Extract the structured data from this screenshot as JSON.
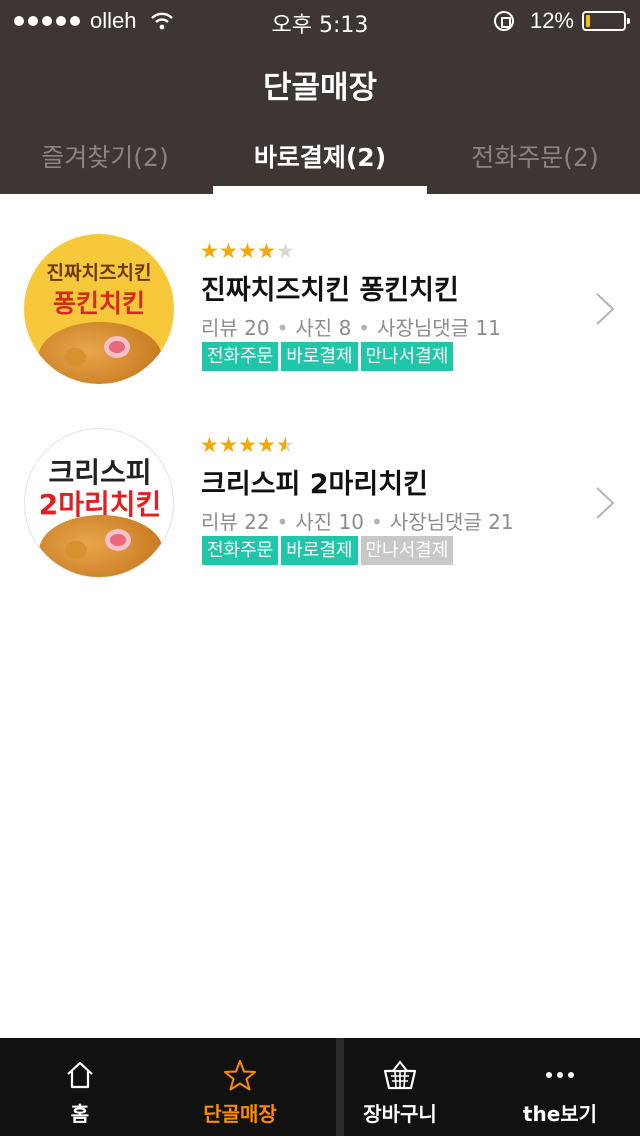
{
  "status_bar": {
    "signal_dots": 5,
    "carrier": "olleh",
    "time": "오후 5:13",
    "battery_percent": "12%",
    "battery_level": 0.12,
    "icons": [
      "wifi-icon",
      "rotation-lock-icon",
      "battery-icon"
    ]
  },
  "header": {
    "title": "단골매장",
    "background": "#3d3632"
  },
  "tabs": [
    {
      "label": "즐겨찾기(2)",
      "active": false
    },
    {
      "label": "바로결제(2)",
      "active": true
    },
    {
      "label": "전화주문(2)",
      "active": false
    }
  ],
  "stores": [
    {
      "thumbnail": {
        "text_top": "진짜치즈치킨",
        "text_bottom": "퐁킨치킨",
        "background": "#f7c93a"
      },
      "rating": 4,
      "name": "진짜치즈치킨 퐁킨치킨",
      "review_label": "리뷰 20",
      "photo_label": "사진 8",
      "owner_reply_label": "사장님댓글 11",
      "badges": [
        {
          "label": "전화주문",
          "enabled": true
        },
        {
          "label": "바로결제",
          "enabled": true
        },
        {
          "label": "만나서결제",
          "enabled": true
        }
      ]
    },
    {
      "thumbnail": {
        "text_top": "크리스피",
        "text_bottom": "2마리치킨",
        "background": "#ffffff"
      },
      "rating": 4.5,
      "name": "크리스피 2마리치킨",
      "review_label": "리뷰 22",
      "photo_label": "사진 10",
      "owner_reply_label": "사장님댓글 21",
      "badges": [
        {
          "label": "전화주문",
          "enabled": true
        },
        {
          "label": "바로결제",
          "enabled": true
        },
        {
          "label": "만나서결제",
          "enabled": false
        }
      ]
    }
  ],
  "colors": {
    "accent_orange": "#ff8a00",
    "badge_teal": "#1fc6a8",
    "badge_disabled": "#c8c8c8",
    "star_gold": "#f5a800"
  },
  "bottom_nav": [
    {
      "label": "홈",
      "icon": "home-icon",
      "active": false
    },
    {
      "label": "단골매장",
      "icon": "star-icon",
      "active": true
    },
    {
      "label": "장바구니",
      "icon": "basket-icon",
      "active": false
    },
    {
      "label": "the보기",
      "icon": "more-dots-icon",
      "active": false
    }
  ]
}
